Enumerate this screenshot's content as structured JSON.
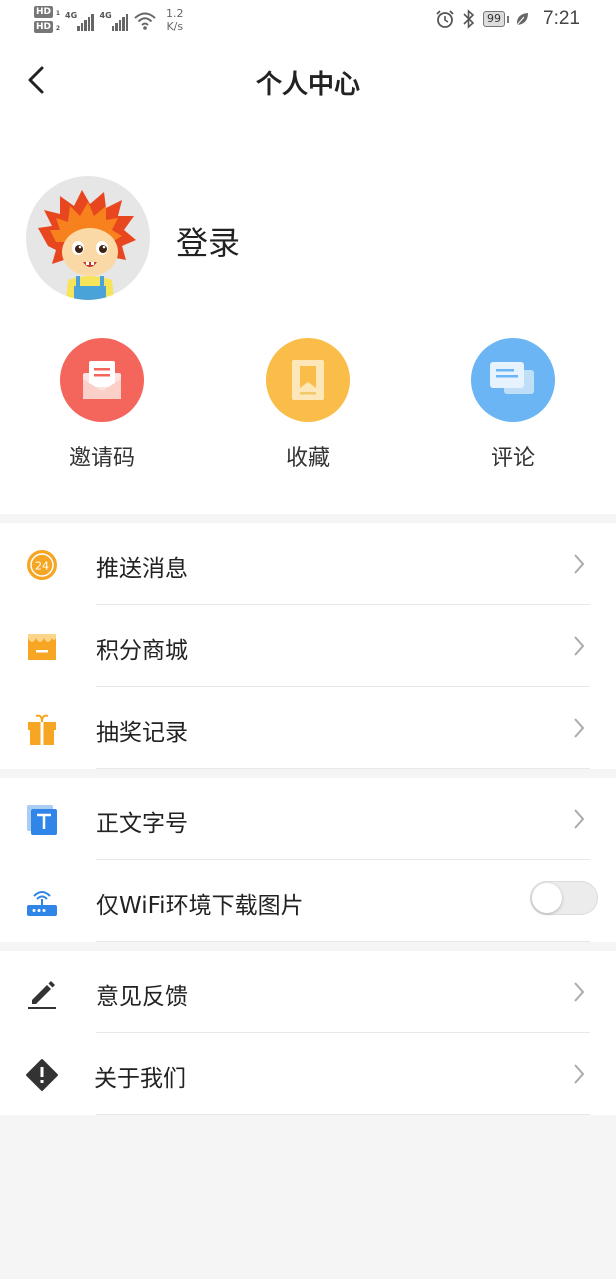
{
  "status_bar": {
    "sim1": "HD",
    "sim1_sub": "1",
    "sim2": "HD",
    "sim2_sub": "2",
    "network1": "4G",
    "network2": "4G",
    "speed_value": "1.2",
    "speed_unit": "K/s",
    "battery": "99",
    "time": "7:21"
  },
  "header": {
    "title": "个人中心",
    "back_icon": "chevron-left-icon"
  },
  "profile": {
    "login_label": "登录",
    "avatar_icon": "lion-cartoon-avatar"
  },
  "quick_actions": [
    {
      "label": "邀请码",
      "icon": "envelope-icon",
      "color": "#f4665c"
    },
    {
      "label": "收藏",
      "icon": "bookmark-icon",
      "color": "#fbbd4a"
    },
    {
      "label": "评论",
      "icon": "comment-icon",
      "color": "#6bb5f5"
    }
  ],
  "menu_group1": [
    {
      "label": "推送消息",
      "icon": "clock-24-icon"
    },
    {
      "label": "积分商城",
      "icon": "store-icon"
    },
    {
      "label": "抽奖记录",
      "icon": "gift-icon"
    }
  ],
  "menu_group2": [
    {
      "label": "正文字号",
      "icon": "font-size-icon"
    },
    {
      "label": "仅WiFi环境下载图片",
      "icon": "router-icon",
      "toggle_on": false
    }
  ],
  "menu_group3": [
    {
      "label": "意见反馈",
      "icon": "pencil-icon"
    },
    {
      "label": "关于我们",
      "icon": "warning-diamond-icon"
    }
  ],
  "colors": {
    "background": "#f5f5f5",
    "orange": "#f6a623",
    "blue": "#2f86e8",
    "dark_icon": "#333333"
  }
}
